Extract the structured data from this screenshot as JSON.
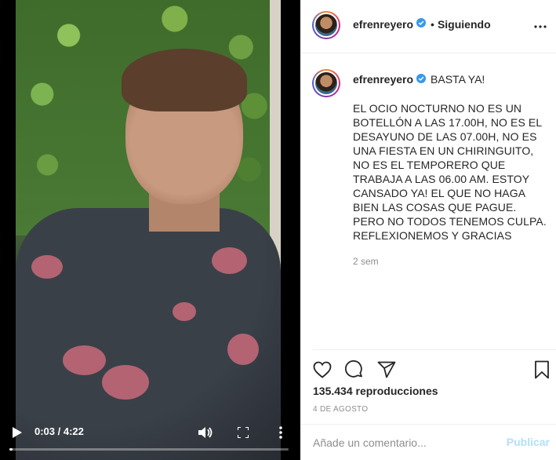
{
  "video": {
    "time_display": "0:03 / 4:22",
    "progress": 0.012
  },
  "header": {
    "username": "efrenreyero",
    "separator": "•",
    "follow_status": "Siguiendo"
  },
  "caption": {
    "username": "efrenreyero",
    "title": "BASTA YA!",
    "text": "EL OCIO NOCTURNO NO ES UN BOTELLÓN A LAS 17.00H, NO ES EL DESAYUNO DE LAS 07.00H, NO ES UNA FIESTA EN UN CHIRINGUITO, NO ES EL TEMPORERO QUE TRABAJA A LAS 06.00 AM. ESTOY CANSADO YA! EL QUE NO HAGA BIEN LAS COSAS QUE PAGUE. PERO NO TODOS TENEMOS CULPA. REFLEXIONEMOS Y GRACIAS",
    "time_ago": "2 sem"
  },
  "stats": {
    "views": "135.434 reproducciones",
    "date": "4 DE AGOSTO"
  },
  "comment": {
    "placeholder": "Añade un comentario...",
    "publish_label": "Publicar"
  },
  "colors": {
    "verified": "#3897f0",
    "link_disabled": "#b2dffc",
    "muted": "#8e8e8e"
  },
  "icons": [
    "play-icon",
    "volume-icon",
    "fullscreen-icon",
    "more-vertical-icon",
    "verified-icon",
    "more-horizontal-icon",
    "heart-icon",
    "comment-icon",
    "share-icon",
    "bookmark-icon"
  ]
}
